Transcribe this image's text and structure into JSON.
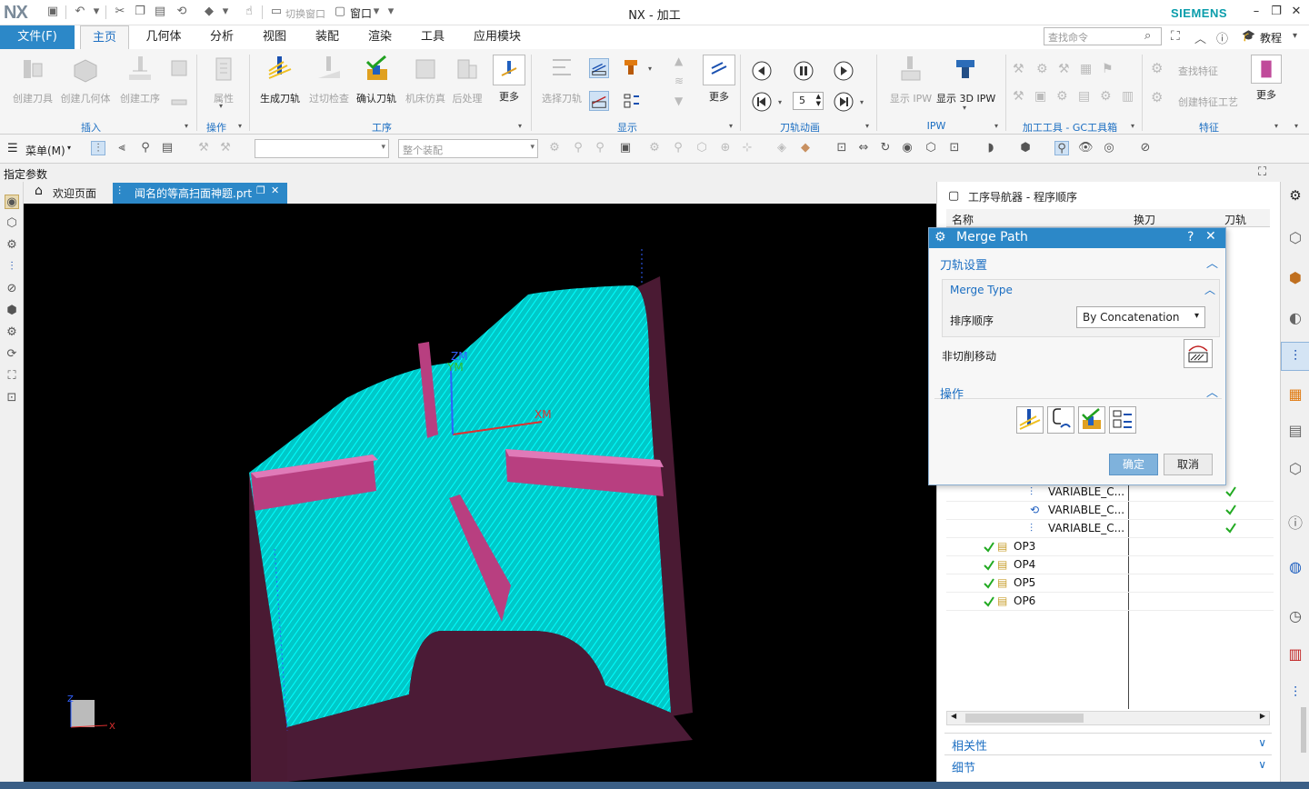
{
  "app": {
    "logo": "NX",
    "title": "NX - 加工",
    "brand": "SIEMENS",
    "quick_access": {
      "switch_window": "切换窗口",
      "window": "窗口"
    }
  },
  "menu": {
    "file": "文件(F)",
    "tabs": [
      {
        "label": "主页",
        "active": true
      },
      {
        "label": "几何体"
      },
      {
        "label": "分析"
      },
      {
        "label": "视图"
      },
      {
        "label": "装配"
      },
      {
        "label": "渲染"
      },
      {
        "label": "工具"
      },
      {
        "label": "应用模块"
      }
    ],
    "search_placeholder": "查找命令",
    "tutorial": "教程"
  },
  "ribbon": {
    "insert": {
      "create_tool": "创建刀具",
      "create_geometry": "创建几何体",
      "create_operation": "创建工序",
      "group": "插入"
    },
    "operation": {
      "properties": "属性",
      "group": "操作"
    },
    "process": {
      "generate": "生成刀轨",
      "overcut_check": "过切检查",
      "verify": "确认刀轨",
      "machine_sim": "机床仿真",
      "postprocess": "后处理",
      "more": "更多",
      "group": "工序"
    },
    "display": {
      "select_tool": "选择刀轨",
      "more": "更多",
      "group": "显示"
    },
    "animation": {
      "speed": "5",
      "group": "刀轨动画"
    },
    "ipw": {
      "show_ipw": "显示 IPW",
      "show_3d_ipw": "显示 3D IPW",
      "group": "IPW"
    },
    "gc": {
      "group": "加工工具 - GC工具箱"
    },
    "features": {
      "find_feature": "查找特征",
      "create_feature_process": "创建特征工艺",
      "more": "更多",
      "group": "特征"
    }
  },
  "toolbar2": {
    "menu": "菜单(M)",
    "filter_placeholder": "",
    "assembly_scope": "整个装配"
  },
  "status": {
    "prompt": "指定参数"
  },
  "graphics_tabs": {
    "welcome": "欢迎页面",
    "part": "闻名的等高扫面神题.prt"
  },
  "viewport": {
    "axis_z": "ZM",
    "axis_y": "YM",
    "axis_x": "XM",
    "triad_x": "X",
    "triad_z": "Z"
  },
  "navigator": {
    "title": "工序导航器 - 程序顺序",
    "columns": {
      "name": "名称",
      "tool_change": "换刀",
      "path": "刀轨"
    },
    "rows": [
      {
        "name": "VARIABLE_C...",
        "check": true
      },
      {
        "name": "VARIABLE_C...",
        "check": true
      },
      {
        "name": "VARIABLE_C...",
        "check": true
      },
      {
        "name": "OP3",
        "check": true
      },
      {
        "name": "OP4",
        "check": true
      },
      {
        "name": "OP5",
        "check": true
      },
      {
        "name": "OP6",
        "check": true
      }
    ],
    "accordion": {
      "dependencies": "相关性",
      "details": "细节"
    }
  },
  "dialog": {
    "title": "Merge Path",
    "help": "?",
    "close": "✕",
    "section_toolpath": "刀轨设置",
    "merge_type_title": "Merge Type",
    "sort_label": "排序顺序",
    "sort_value": "By Concatenation",
    "noncut_label": "非切削移动",
    "section_actions": "操作",
    "ok": "确定",
    "cancel": "取消"
  },
  "colors": {
    "accent_blue": "#2c88c8",
    "toolpath_cyan": "#00e6e6",
    "part_magenta": "#b83f80",
    "check_green": "#22aa22"
  }
}
